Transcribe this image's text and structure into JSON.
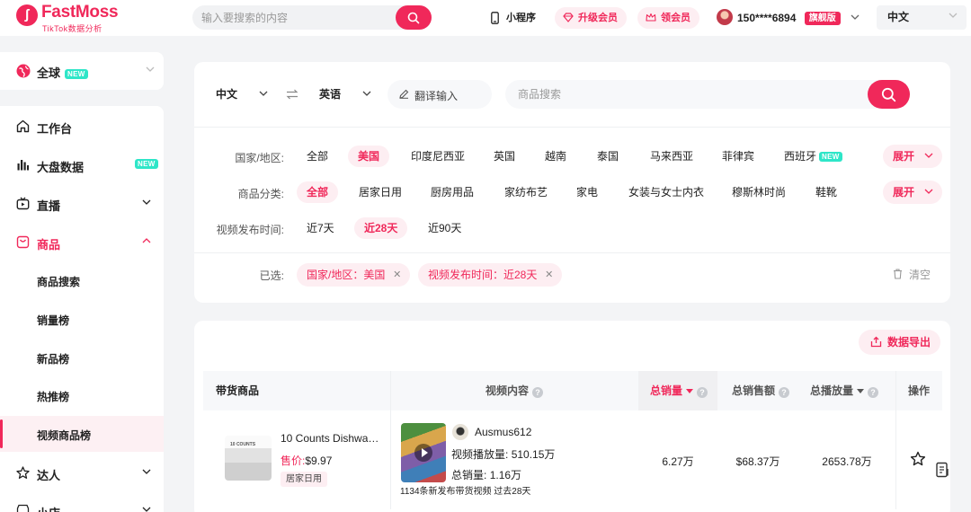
{
  "header": {
    "logo_name": "FastMoss",
    "logo_sub": "TikTok数据分析",
    "search_placeholder": "输入要搜索的内容",
    "miniprogram": "小程序",
    "upgrade": "升级会员",
    "claim": "领会员",
    "user_phone": "150****6894",
    "plan_badge": "旗舰版",
    "language": "中文"
  },
  "sidebar": {
    "region": "全球",
    "new_tag": "NEW",
    "items": [
      {
        "label": "工作台",
        "icon": "home-icon"
      },
      {
        "label": "大盘数据",
        "icon": "bar-chart-icon",
        "new": "NEW"
      },
      {
        "label": "直播",
        "icon": "live-icon"
      },
      {
        "label": "商品",
        "icon": "bag-icon"
      },
      {
        "label": "达人",
        "icon": "star-person-icon"
      },
      {
        "label": "小店",
        "icon": "shop-icon"
      }
    ],
    "subitems": [
      "商品搜索",
      "销量榜",
      "新品榜",
      "热推榜",
      "视频商品榜"
    ]
  },
  "filters": {
    "source_lang": "中文",
    "target_lang": "英语",
    "translate_label": "翻译输入",
    "product_search_placeholder": "商品搜索",
    "region_label": "国家/地区:",
    "regions": [
      "全部",
      "美国",
      "印度尼西亚",
      "英国",
      "越南",
      "泰国",
      "马来西亚",
      "菲律宾",
      "西班牙"
    ],
    "region_new": "NEW",
    "category_label": "商品分类:",
    "categories": [
      "全部",
      "居家日用",
      "厨房用品",
      "家纺布艺",
      "家电",
      "女装与女士内衣",
      "穆斯林时尚",
      "鞋靴"
    ],
    "expand": "展开",
    "time_label": "视频发布时间:",
    "times": [
      "近7天",
      "近28天",
      "近90天"
    ],
    "selected_label": "已选:",
    "selected": [
      "国家/地区：美国",
      "视频发布时间：近28天"
    ],
    "clear": "清空"
  },
  "table": {
    "export": "数据导出",
    "headers": {
      "product": "带货商品",
      "video": "视频内容",
      "total_sales": "总销量",
      "total_revenue": "总销售额",
      "total_views": "总播放量",
      "actions": "操作"
    },
    "rows": [
      {
        "title": "10 Counts Dishwa…",
        "price_label": "售价:",
        "price": "$9.97",
        "category": "居家日用",
        "creator": "Ausmus612",
        "views_label": "视频播放量:",
        "views": "510.15万",
        "sales_label": "总销量:",
        "sales": "1.16万",
        "note": "1134条新发布带货视频 过去28天",
        "total_sales": "6.27万",
        "total_revenue": "$68.37万",
        "total_views": "2653.78万"
      }
    ]
  },
  "colors": {
    "accent": "#f0285a",
    "accent_soft": "#fdeef2",
    "new_badge": "#2ee6c8"
  }
}
